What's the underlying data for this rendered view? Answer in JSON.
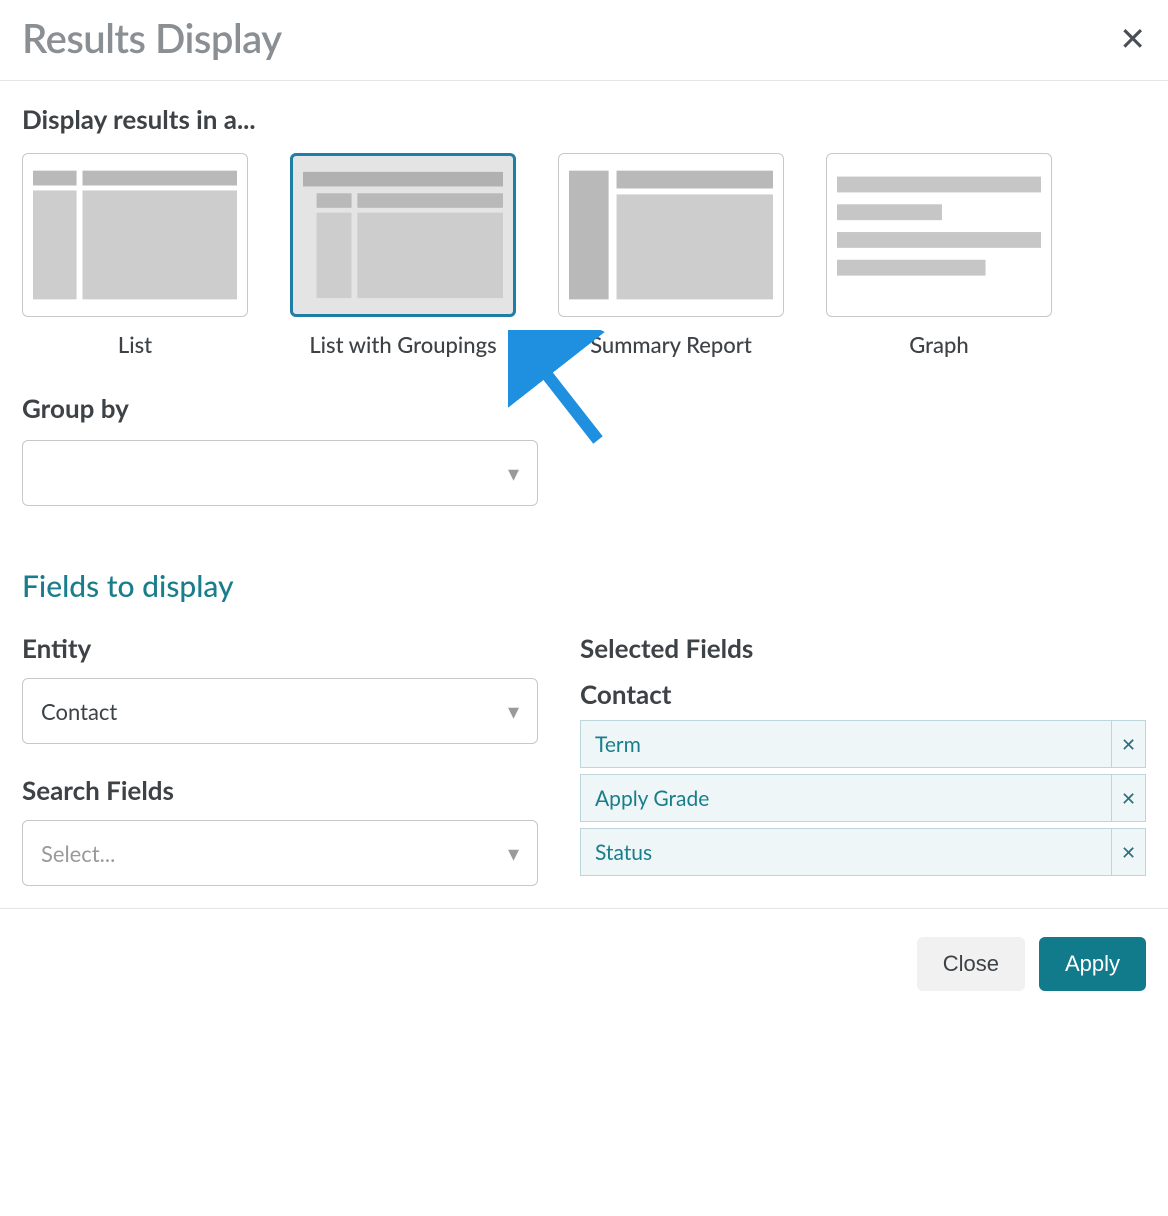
{
  "header": {
    "title": "Results Display"
  },
  "display": {
    "label": "Display results in a...",
    "options": {
      "list": "List",
      "list_groupings": "List with Groupings",
      "summary": "Summary Report",
      "graph": "Graph"
    }
  },
  "group_by": {
    "label": "Group by",
    "value": ""
  },
  "fields_heading": "Fields to display",
  "entity": {
    "label": "Entity",
    "value": "Contact"
  },
  "search_fields": {
    "label": "Search Fields",
    "placeholder": "Select..."
  },
  "selected_fields": {
    "label": "Selected Fields",
    "group_name": "Contact",
    "items": {
      "0": "Term",
      "1": "Apply Grade",
      "2": "Status"
    }
  },
  "footer": {
    "close": "Close",
    "apply": "Apply"
  }
}
